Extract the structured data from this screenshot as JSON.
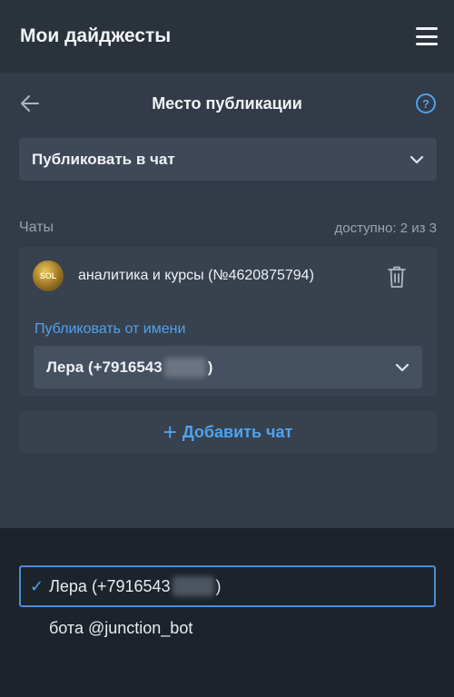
{
  "app": {
    "title": "Мои дайджесты"
  },
  "header": {
    "title": "Место публикации",
    "help_icon_text": "?"
  },
  "publish_mode": {
    "selected": "Публиковать в чат"
  },
  "chats": {
    "label": "Чаты",
    "available": "доступно: 2 из 3",
    "items": [
      {
        "name": "аналитика и курсы (№4620875794)",
        "avatar_text": "SOL",
        "from_label": "Публиковать от имени",
        "author_prefix": "Лера (+7916543",
        "author_suffix": ")"
      }
    ],
    "add_button": "Добавить чат",
    "add_icon": "+"
  },
  "author_dropdown": {
    "options": [
      {
        "prefix": "Лера (+7916543",
        "suffix": ")",
        "selected": true
      },
      {
        "label": "бота @junction_bot",
        "selected": false
      }
    ],
    "check_glyph": "✓"
  },
  "colors": {
    "accent": "#4ea3f0",
    "background": "#323b47",
    "dropdown_bg": "#1d232b"
  }
}
